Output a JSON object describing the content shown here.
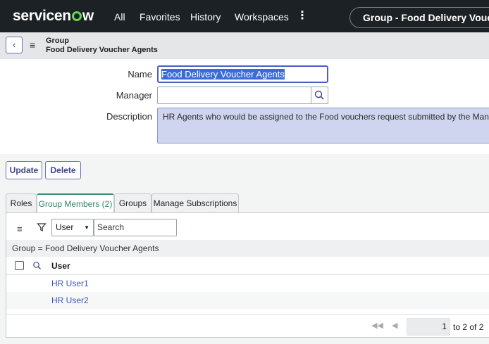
{
  "topnav": {
    "logo": {
      "prefix": "servicen",
      "suffix": "w"
    },
    "items": [
      "All",
      "Favorites",
      "History",
      "Workspaces"
    ],
    "more": "⋮",
    "context_pill": "Group - Food Delivery Voucher Agents"
  },
  "header": {
    "back_glyph": "‹",
    "menu_glyph": "≡",
    "record_type": "Group",
    "record_name": "Food Delivery Voucher Agents"
  },
  "form": {
    "name_label": "Name",
    "name_value": "Food Delivery Voucher Agents",
    "manager_label": "Manager",
    "manager_value": "",
    "description_label": "Description",
    "description_value": "HR Agents who would be assigned to the Food vouchers request submitted by the Managers to help"
  },
  "actions": {
    "update": "Update",
    "delete": "Delete"
  },
  "tabs": [
    {
      "label": "Roles",
      "active": false
    },
    {
      "label": "Group Members (2)",
      "active": true
    },
    {
      "label": "Groups",
      "active": false
    },
    {
      "label": "Manage Subscriptions",
      "active": false
    }
  ],
  "list": {
    "filter_field": "User",
    "search_placeholder": "Search",
    "breadcrumb": "Group = Food Delivery Voucher Agents",
    "column": "User",
    "rows": [
      "HR User1",
      "HR User2"
    ],
    "pager": {
      "page": "1",
      "summary": "to 2 of 2"
    }
  },
  "colors": {
    "nav_bg": "#1c2125",
    "accent": "#4b5ec2",
    "tab_active": "#2d8465",
    "link": "#3e56b7",
    "logo_green": "#62d84e"
  }
}
